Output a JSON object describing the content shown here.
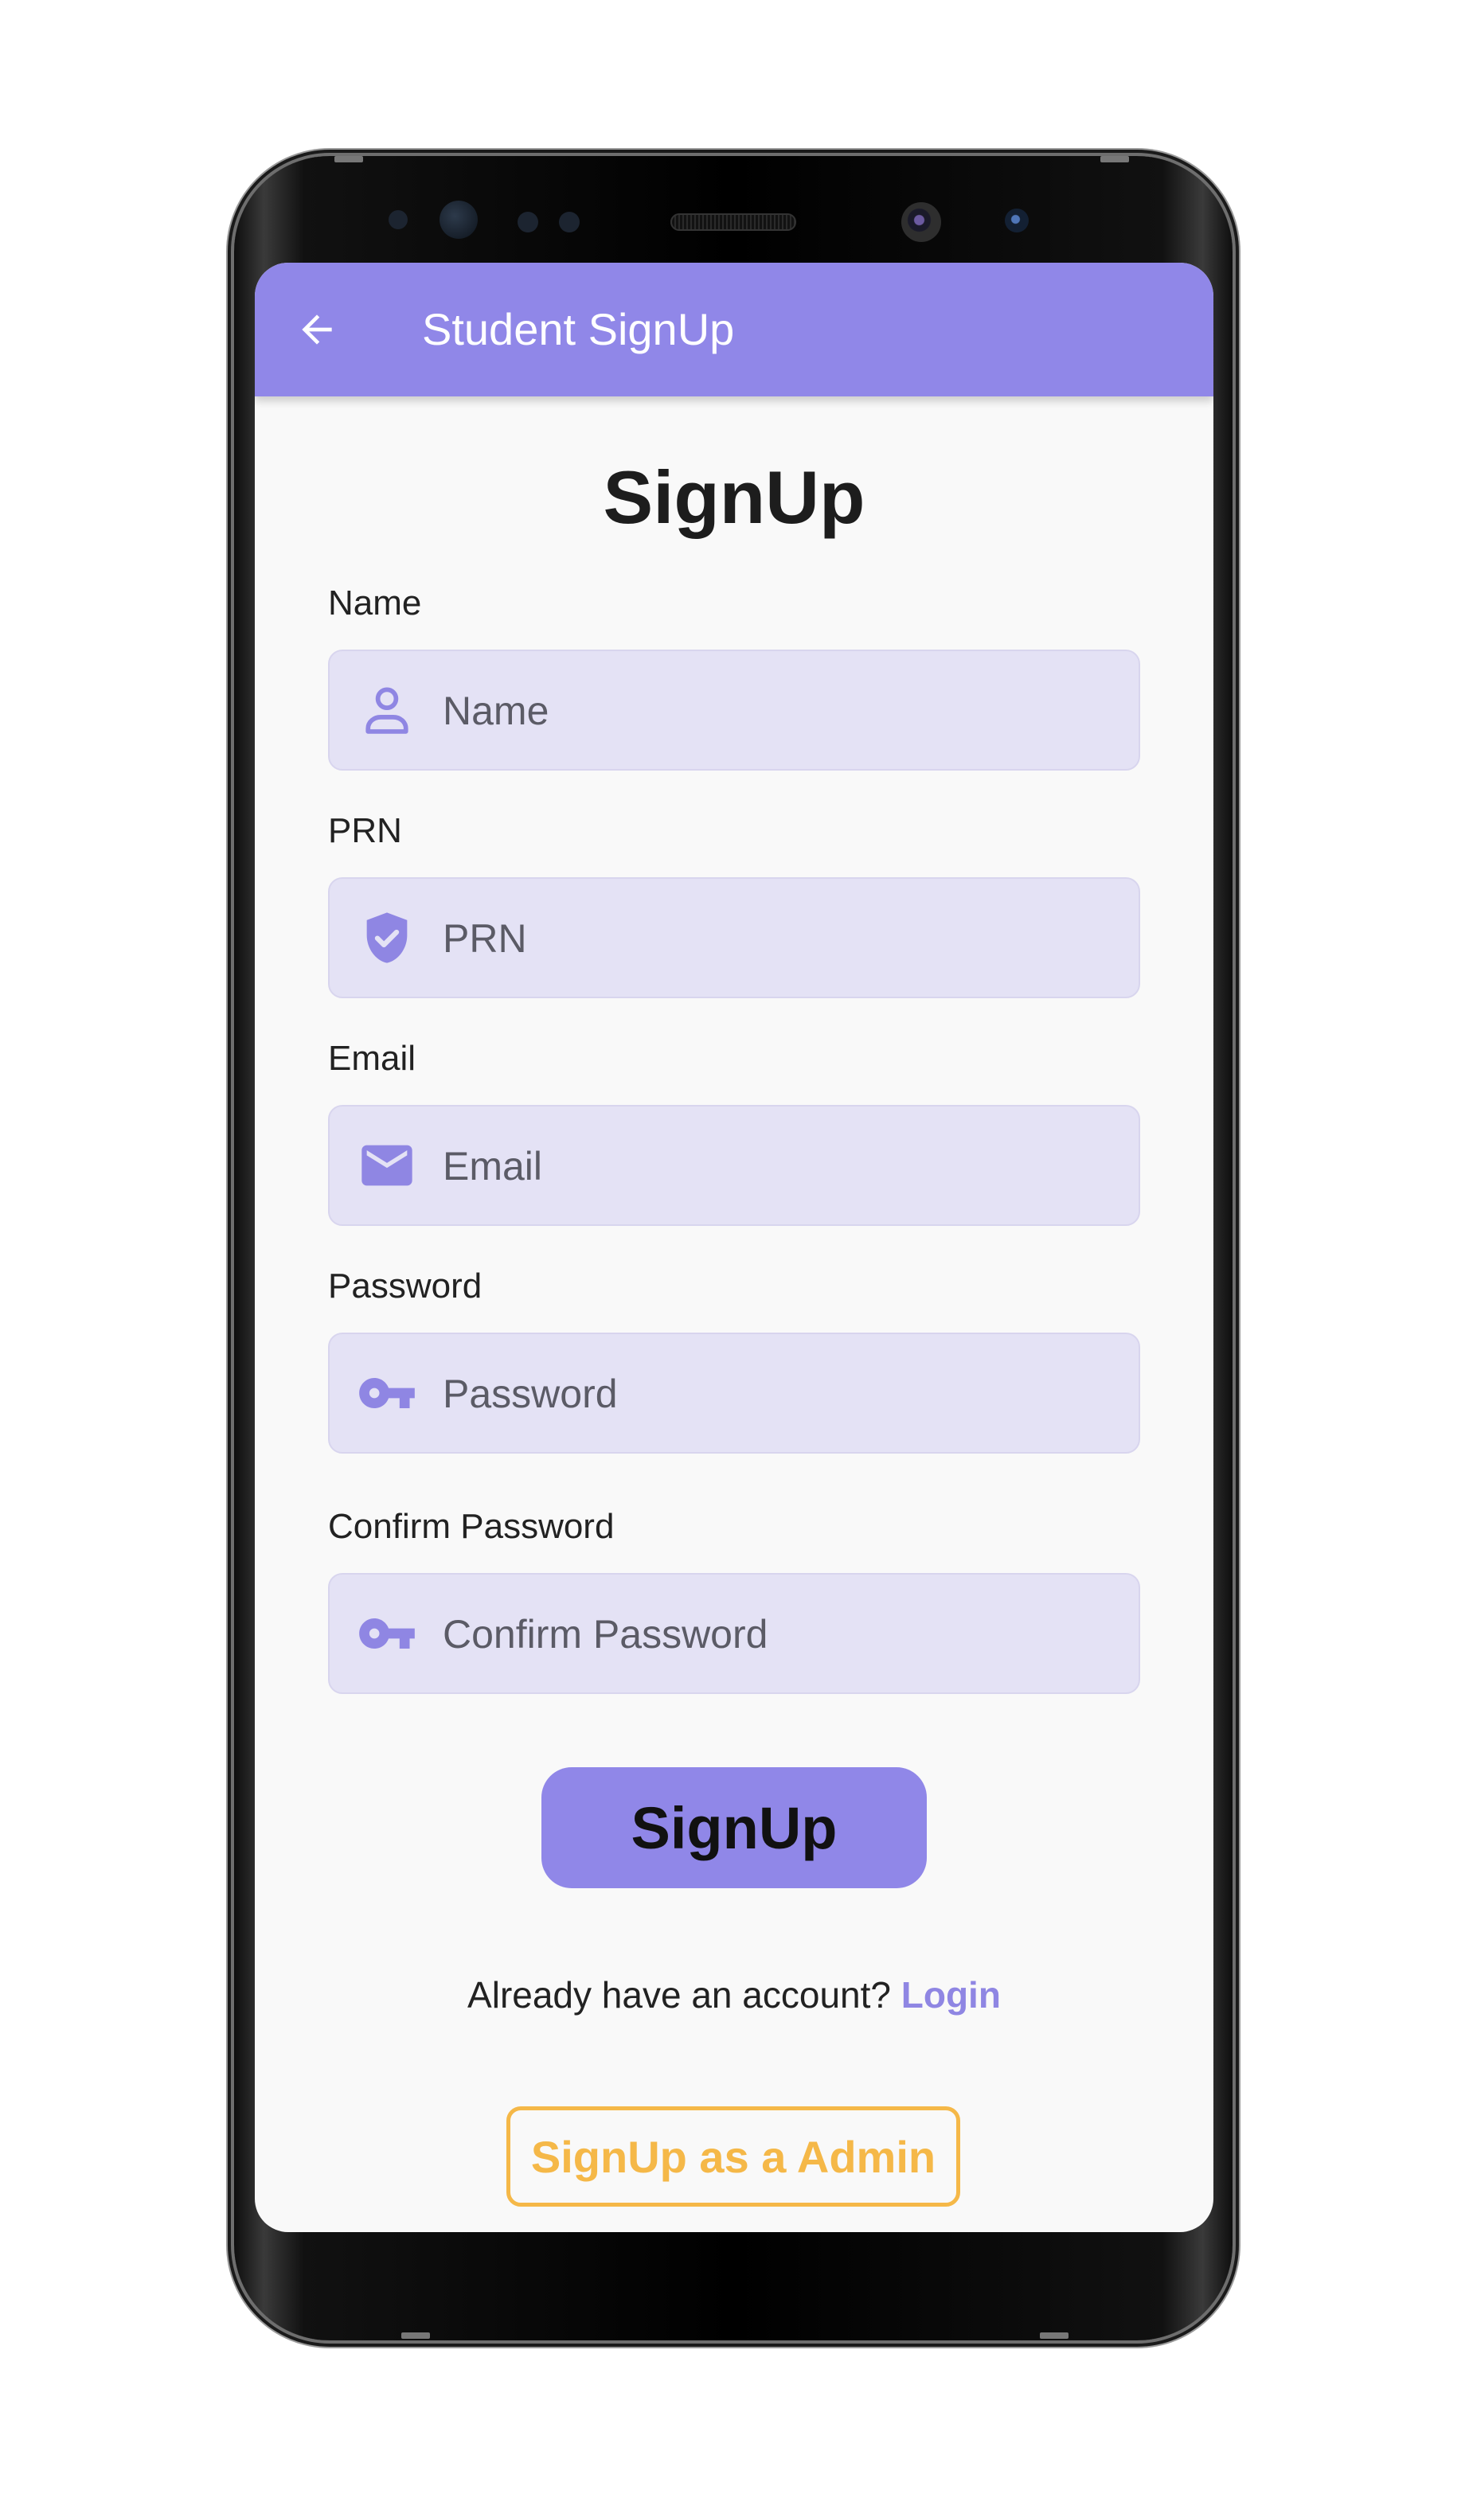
{
  "appbar": {
    "title": "Student SignUp",
    "back_icon": "arrow-left-icon"
  },
  "form": {
    "heading": "SignUp",
    "fields": [
      {
        "label": "Name",
        "placeholder": "Name",
        "value": "",
        "icon": "person-icon"
      },
      {
        "label": "PRN",
        "placeholder": "PRN",
        "value": "",
        "icon": "shield-check-icon"
      },
      {
        "label": "Email",
        "placeholder": "Email",
        "value": "",
        "icon": "mail-icon"
      },
      {
        "label": "Password",
        "placeholder": "Password",
        "value": "",
        "icon": "key-icon"
      },
      {
        "label": "Confirm Password",
        "placeholder": "Confirm Password",
        "value": "",
        "icon": "key-icon"
      }
    ],
    "submit_label": "SignUp",
    "login_prompt": "Already have an account?",
    "login_link": "Login",
    "admin_label": "SignUp as a Admin"
  },
  "colors": {
    "accent": "#9087e8",
    "input_background": "#e4e2f5",
    "admin": "#f5b848",
    "screen_background": "#f9f9f9"
  }
}
